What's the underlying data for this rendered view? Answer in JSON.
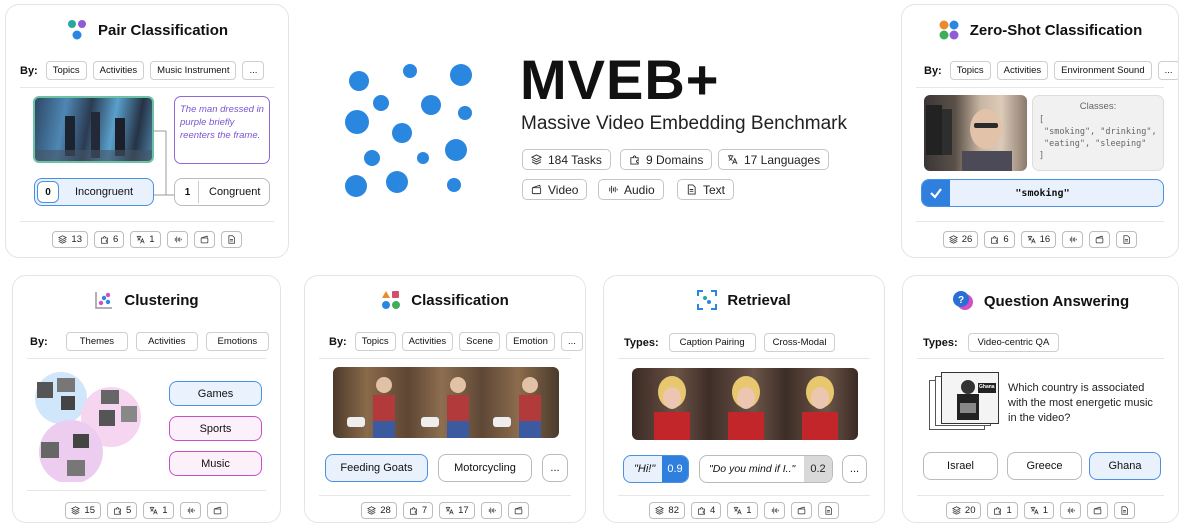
{
  "hero": {
    "title": "MVEB+",
    "subtitle": "Massive Video Embedding Benchmark",
    "pills": {
      "tasks": "184 Tasks",
      "domains": "9 Domains",
      "languages": "17 Languages",
      "video": "Video",
      "audio": "Audio",
      "text": "Text"
    },
    "dot_color": "#2a87e0"
  },
  "pair": {
    "title": "Pair Classification",
    "by_label": "By:",
    "chips": [
      "Topics",
      "Activities",
      "Music Instrument",
      "..."
    ],
    "caption": "The man dressed in purple briefly reenters the frame.",
    "opt1": {
      "num": "0",
      "label": "Incongruent"
    },
    "opt2": {
      "num": "1",
      "label": "Congruent"
    },
    "stats": {
      "tasks": "13",
      "domains": "6",
      "languages": "1"
    }
  },
  "zeroshot": {
    "title": "Zero-Shot Classification",
    "by_label": "By:",
    "chips": [
      "Topics",
      "Activities",
      "Environment Sound",
      "..."
    ],
    "classes_title": "Classes:",
    "classes_open": "[",
    "classes_line1": "\"smoking\", \"drinking\",",
    "classes_line2": "\"eating\", \"sleeping\"",
    "classes_close": "]",
    "answer": "\"smoking\"",
    "stats": {
      "tasks": "26",
      "domains": "6",
      "languages": "16"
    }
  },
  "clustering": {
    "title": "Clustering",
    "by_label": "By:",
    "chips": [
      "Themes",
      "Activities",
      "Emotions"
    ],
    "labels": [
      "Games",
      "Sports",
      "Music"
    ],
    "stats": {
      "tasks": "15",
      "domains": "5",
      "languages": "1"
    }
  },
  "classification": {
    "title": "Classification",
    "by_label": "By:",
    "chips": [
      "Topics",
      "Activities",
      "Scene",
      "Emotion",
      "..."
    ],
    "opt1": "Feeding Goats",
    "opt2": "Motorcycling",
    "more": "...",
    "stats": {
      "tasks": "28",
      "domains": "7",
      "languages": "17"
    }
  },
  "retrieval": {
    "title": "Retrieval",
    "types_label": "Types:",
    "chips": [
      "Caption Pairing",
      "Cross-Modal"
    ],
    "res1": {
      "text": "\"Hi!\"",
      "score": "0.9"
    },
    "res2": {
      "text": "\"Do you mind if I..\"",
      "score": "0.2"
    },
    "more": "...",
    "stats": {
      "tasks": "82",
      "domains": "4",
      "languages": "1"
    }
  },
  "qa": {
    "title": "Question Answering",
    "types_label": "Types:",
    "chips": [
      "Video-centric QA"
    ],
    "thumb_label": "Ghana",
    "question": "Which country is associated with the most energetic music in the video?",
    "answers": [
      "Israel",
      "Greece",
      "Ghana"
    ],
    "stats": {
      "tasks": "20",
      "domains": "1",
      "languages": "1"
    }
  },
  "colors": {
    "accent": "#4a90e2",
    "pink": "#c651c6",
    "border": "#e4e4e4"
  }
}
